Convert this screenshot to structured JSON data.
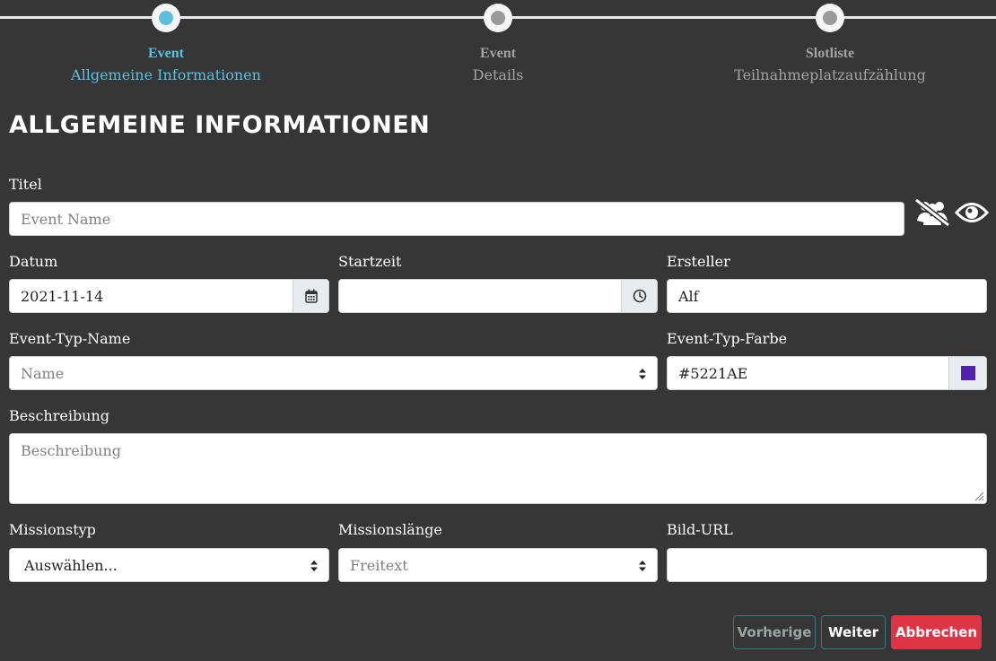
{
  "stepper": {
    "steps": [
      {
        "title": "Event",
        "subtitle": "Allgemeine Informationen",
        "state": "active"
      },
      {
        "title": "Event",
        "subtitle": "Details",
        "state": "inactive"
      },
      {
        "title": "Slotliste",
        "subtitle": "Teilnahmeplatzaufzählung",
        "state": "inactive"
      }
    ]
  },
  "page_title": "ALLGEMEINE INFORMATIONEN",
  "form": {
    "titel": {
      "label": "Titel",
      "placeholder": "Event Name"
    },
    "datum": {
      "label": "Datum",
      "value": "2021-11-14"
    },
    "startzeit": {
      "label": "Startzeit",
      "value": ""
    },
    "ersteller": {
      "label": "Ersteller",
      "value": "Alf"
    },
    "event_typ_name": {
      "label": "Event-Typ-Name",
      "placeholder": "Name"
    },
    "event_typ_farbe": {
      "label": "Event-Typ-Farbe",
      "value": "#5221AE",
      "swatch": "#5221ae"
    },
    "beschreibung": {
      "label": "Beschreibung",
      "placeholder": "Beschreibung"
    },
    "missionstyp": {
      "label": "Missionstyp",
      "selected": "Auswählen..."
    },
    "missionslaenge": {
      "label": "Missionslänge",
      "placeholder": "Freitext"
    },
    "bild_url": {
      "label": "Bild-URL",
      "value": ""
    }
  },
  "icons": {
    "visibility_group": "users-slash-icon",
    "visibility_eye": "eye-icon"
  },
  "buttons": {
    "prev": "Vorherige",
    "next": "Weiter",
    "cancel": "Abbrechen"
  },
  "colors": {
    "background": "#363636",
    "accent": "#5bc0de",
    "danger": "#dc3545",
    "event_color": "#5221ae"
  }
}
